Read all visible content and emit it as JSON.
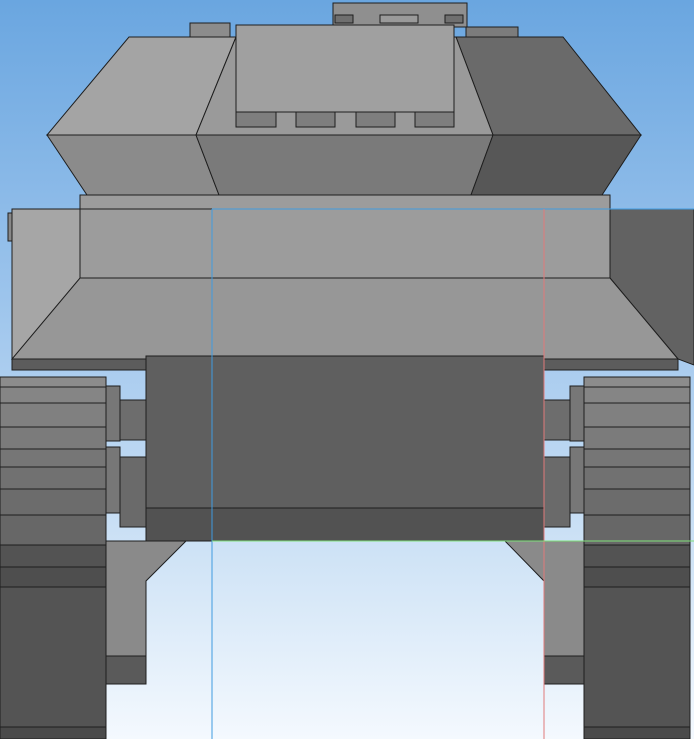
{
  "viewport": {
    "background_top": "#6aa6e0",
    "background_bottom": "#f4f9fe"
  },
  "model": {
    "kind": "3d-cad-front-view",
    "subject": "tracked-vehicle"
  },
  "axes_overlay": {
    "blue_axis_color": "#3f9be0",
    "red_axis_color": "#e07a7a",
    "green_axis_color": "#7fe07a"
  }
}
